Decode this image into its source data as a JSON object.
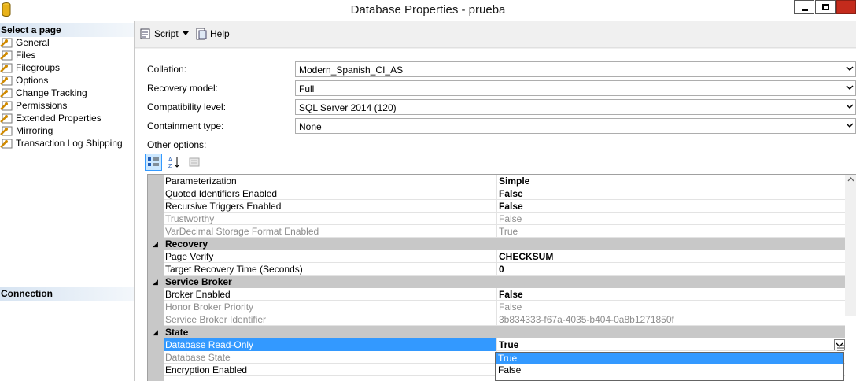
{
  "window": {
    "title": "Database Properties - prueba"
  },
  "left_pane": {
    "select_page_header": "Select a page",
    "pages": [
      "General",
      "Files",
      "Filegroups",
      "Options",
      "Change Tracking",
      "Permissions",
      "Extended Properties",
      "Mirroring",
      "Transaction Log Shipping"
    ],
    "connection_header": "Connection"
  },
  "toolbar": {
    "script_label": "Script",
    "help_label": "Help"
  },
  "fields": [
    {
      "label": "Collation:",
      "value": "Modern_Spanish_CI_AS"
    },
    {
      "label": "Recovery model:",
      "value": "Full"
    },
    {
      "label": "Compatibility level:",
      "value": "SQL Server 2014 (120)"
    },
    {
      "label": "Containment type:",
      "value": "None"
    }
  ],
  "other_options_label": "Other options:",
  "properties": [
    {
      "name": "Parameterization",
      "value": "Simple"
    },
    {
      "name": "Quoted Identifiers Enabled",
      "value": "False"
    },
    {
      "name": "Recursive Triggers Enabled",
      "value": "False"
    },
    {
      "name": "Trustworthy",
      "value": "False"
    },
    {
      "name": "VarDecimal Storage Format Enabled",
      "value": "True"
    },
    {
      "name": "Recovery"
    },
    {
      "name": "Page Verify",
      "value": "CHECKSUM"
    },
    {
      "name": "Target Recovery Time (Seconds)",
      "value": "0"
    },
    {
      "name": "Service Broker"
    },
    {
      "name": "Broker Enabled",
      "value": "False"
    },
    {
      "name": "Honor Broker Priority",
      "value": "False"
    },
    {
      "name": "Service Broker Identifier",
      "value": "3b834333-f67a-4035-b404-0a8b1271850f"
    },
    {
      "name": "State"
    },
    {
      "name": "Database Read-Only",
      "value": "True"
    },
    {
      "name": "Database State"
    },
    {
      "name": "Encryption Enabled"
    }
  ],
  "dropdown_options": [
    "True",
    "False"
  ],
  "colors": {
    "selection": "#3399ff",
    "category_band": "#c8c8c8",
    "close_button": "#c42b1c"
  }
}
